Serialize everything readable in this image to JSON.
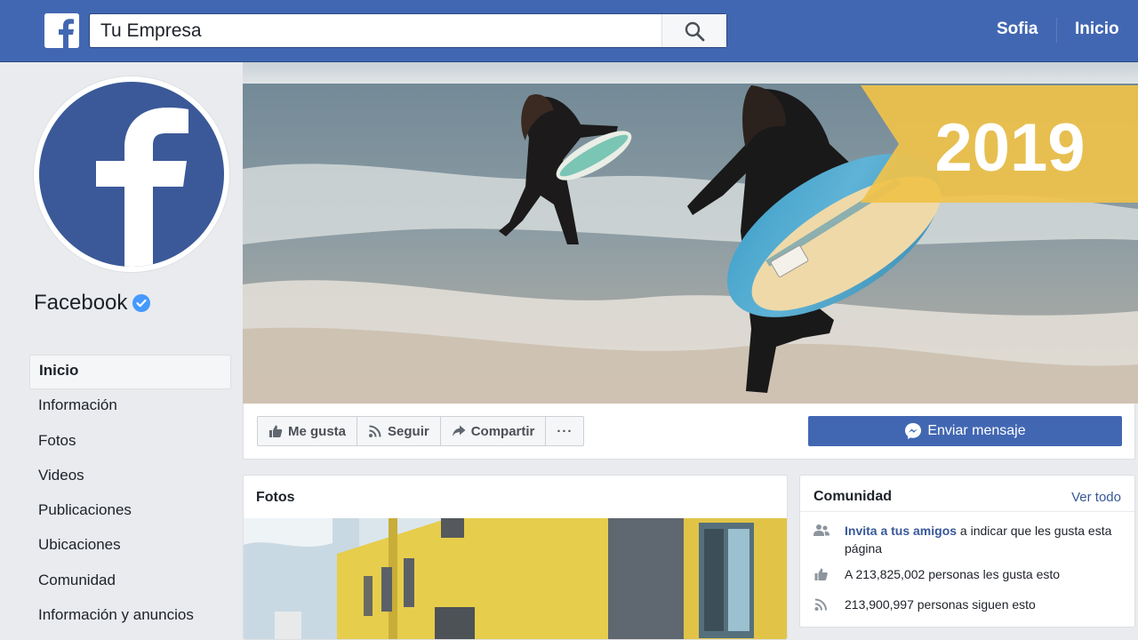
{
  "topbar": {
    "search_value": "Tu Empresa",
    "nav": [
      "Sofia",
      "Inicio"
    ]
  },
  "profile": {
    "name": "Facebook"
  },
  "sidebar": {
    "items": [
      {
        "label": "Inicio",
        "active": true
      },
      {
        "label": "Información"
      },
      {
        "label": "Fotos"
      },
      {
        "label": "Videos"
      },
      {
        "label": "Publicaciones"
      },
      {
        "label": "Ubicaciones"
      },
      {
        "label": "Comunidad"
      },
      {
        "label": "Información y anuncios"
      }
    ]
  },
  "cover": {
    "badge": "2019"
  },
  "actions": {
    "like": "Me gusta",
    "follow": "Seguir",
    "share": "Compartir",
    "more": "···",
    "message": "Enviar mensaje"
  },
  "photos": {
    "title": "Fotos"
  },
  "community": {
    "title": "Comunidad",
    "see_all": "Ver todo",
    "invite_link": "Invita a tus amigos",
    "invite_rest": " a indicar que les gusta esta página",
    "likes": "A 213,825,002 personas les gusta esto",
    "follows": "213,900,997 personas siguen esto"
  },
  "colors": {
    "brand": "#4267b2",
    "badge": "#f0c24a"
  }
}
